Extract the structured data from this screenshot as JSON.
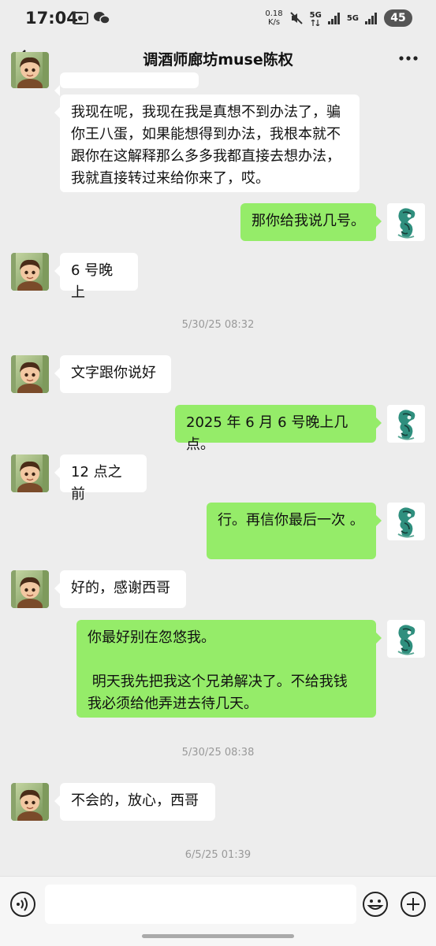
{
  "status_bar": {
    "time": "17:04",
    "net_speed_value": "0.18",
    "net_speed_unit": "K/s",
    "signal1_label": "5G",
    "signal2_label": "5G",
    "battery": "45"
  },
  "header": {
    "title": "调酒师廊坊muse陈权"
  },
  "messages": [
    {
      "side": "in",
      "text": "我现在呢，我现在我是真想不到办法了，骗\n你王八蛋，如果能想得到办法，我根本就不\n跟你在这解释那么多多我都直接去想办法，\n我就直接转过来给你来了，哎。"
    },
    {
      "side": "out",
      "text": "那你给我说几号。"
    },
    {
      "side": "in",
      "text": "6 号晚上"
    },
    {
      "type": "timestamp",
      "text": "5/30/25 08:32"
    },
    {
      "side": "in",
      "text": "文字跟你说好"
    },
    {
      "side": "out",
      "text": "2025 年 6 月 6 号晚上几点。"
    },
    {
      "side": "in",
      "text": "12 点之前"
    },
    {
      "side": "out",
      "text": "行。再信你最后一次 。"
    },
    {
      "side": "in",
      "text": "好的，感谢西哥"
    },
    {
      "side": "out",
      "text": "你最好别在忽悠我。\n\n 明天我先把我这个兄弟解决了。不给我钱\n我必须给他弄进去待几天。"
    },
    {
      "type": "timestamp",
      "text": "5/30/25 08:38"
    },
    {
      "side": "in",
      "text": "不会的，放心，西哥"
    },
    {
      "type": "timestamp",
      "text": "6/5/25 01:39"
    }
  ],
  "input_bar": {
    "placeholder": ""
  }
}
